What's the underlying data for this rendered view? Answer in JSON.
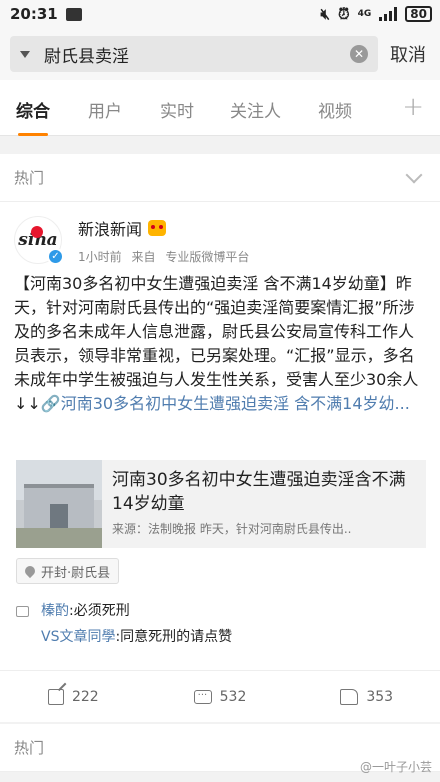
{
  "status_bar": {
    "time": "20:31",
    "network": "4G",
    "battery": "80"
  },
  "search": {
    "query": "尉氏县卖淫",
    "cancel_label": "取消"
  },
  "tabs": [
    {
      "label": "综合",
      "active": true
    },
    {
      "label": "用户",
      "active": false
    },
    {
      "label": "实时",
      "active": false
    },
    {
      "label": "关注人",
      "active": false
    },
    {
      "label": "视频",
      "active": false
    }
  ],
  "section": {
    "hot_label": "热门"
  },
  "post": {
    "avatar_text": "sina",
    "author": "新浪新闻",
    "time": "1小时前",
    "from_label": "来自",
    "source_app": "专业版微博平台",
    "text_main": "【河南30多名初中女生遭强迫卖淫 含不满14岁幼童】昨天，针对河南尉氏县传出的“强迫卖淫简要案情汇报”所涉及的多名未成年人信息泄露，尉氏县公安局宣传科工作人员表示，领导非常重视，已另案处理。“汇报”显示，多名未成年中学生被强迫与人发生性关系，受害人至少30余人↓↓",
    "text_link": "🔗河南30多名初中女生遭强迫卖淫 含不满14岁幼...",
    "link_card": {
      "title": "河南30多名初中女生遭强迫卖淫含不满14岁幼童",
      "source": "来源：法制晚报 昨天，针对河南尉氏县传出.."
    },
    "location": "开封·尉氏县",
    "comments": [
      {
        "user": "榛酌",
        "text": ":必须死刑"
      },
      {
        "user": "VS文章同學",
        "text": ":同意死刑的请点赞"
      }
    ],
    "actions": {
      "reposts": "222",
      "comments": "532",
      "likes": "353"
    }
  },
  "watermark": "@一叶子小芸"
}
